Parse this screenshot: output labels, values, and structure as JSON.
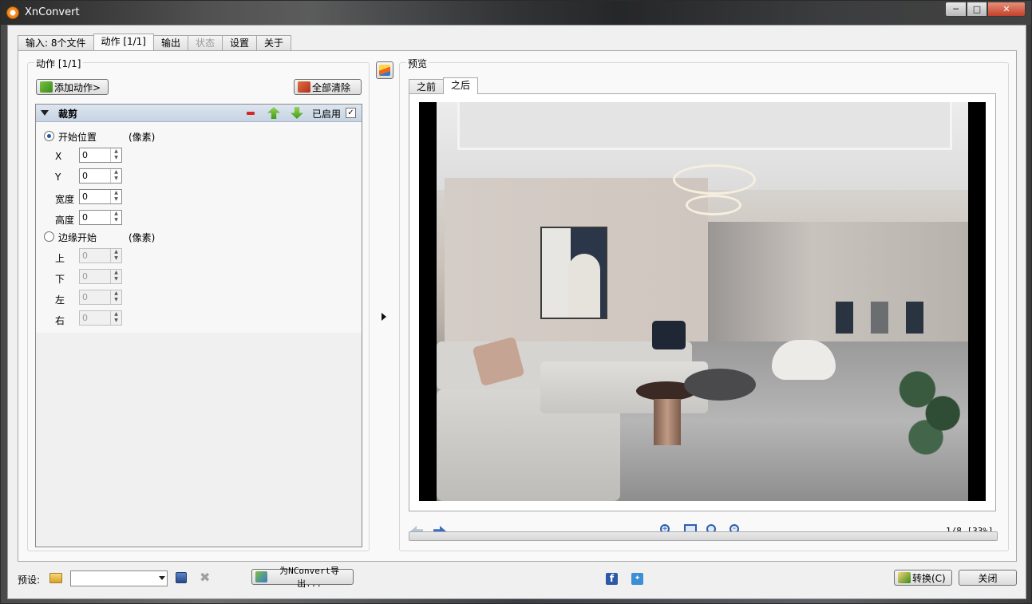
{
  "window": {
    "title": "XnConvert"
  },
  "tabs": [
    {
      "label": "输入: 8个文件",
      "state": "normal"
    },
    {
      "label": "动作 [1/1]",
      "state": "active"
    },
    {
      "label": "输出",
      "state": "normal"
    },
    {
      "label": "状态",
      "state": "disabled"
    },
    {
      "label": "设置",
      "state": "normal"
    },
    {
      "label": "关于",
      "state": "normal"
    }
  ],
  "actions": {
    "group_label": "动作 [1/1]",
    "add_button": "添加动作>",
    "clear_button": "全部清除",
    "item": {
      "title": "裁剪",
      "enabled_label": "已启用",
      "enabled": true,
      "mode_start": "开始位置",
      "unit_start": "(像素)",
      "fields_start": [
        {
          "label": "X",
          "value": "0"
        },
        {
          "label": "Y",
          "value": "0"
        },
        {
          "label": "宽度",
          "value": "0"
        },
        {
          "label": "高度",
          "value": "0"
        }
      ],
      "mode_edge": "边缘开始",
      "unit_edge": "(像素)",
      "fields_edge": [
        {
          "label": "上",
          "value": "0"
        },
        {
          "label": "下",
          "value": "0"
        },
        {
          "label": "左",
          "value": "0"
        },
        {
          "label": "右",
          "value": "0"
        }
      ]
    }
  },
  "preview": {
    "group_label": "预览",
    "tab_before": "之前",
    "tab_after": "之后",
    "page_info": "1/8 [33%]"
  },
  "bottom": {
    "preset_label": "预设:",
    "preset_value": "",
    "export_button": "为NConvert导出...",
    "convert_button": "转换(C)",
    "close_button": "关闭"
  },
  "colors": {
    "accent": "#1e5a9e",
    "header": "#c6d3e2",
    "close": "#c4402c"
  }
}
